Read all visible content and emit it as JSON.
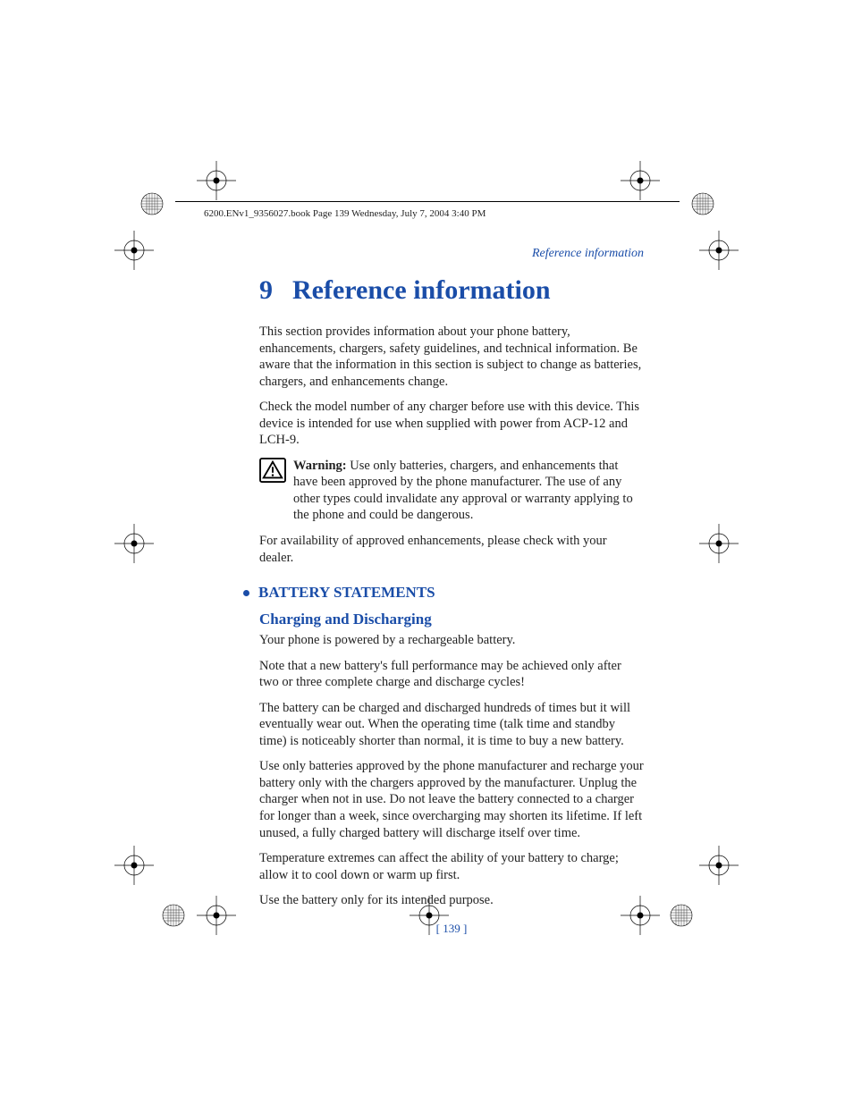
{
  "header": {
    "bookline": "6200.ENv1_9356027.book  Page 139  Wednesday, July 7, 2004  3:40 PM"
  },
  "running_head": "Reference information",
  "chapter": {
    "number": "9",
    "title": "Reference information"
  },
  "paragraphs": {
    "p1": "This section provides information about your phone battery, enhancements, chargers, safety guidelines, and technical information. Be aware that the information in this section is subject to change as batteries, chargers, and enhancements change.",
    "p2": "Check the model number of any charger before use with this device. This device is intended for use when supplied with power from ACP-12 and LCH-9.",
    "warning_label": "Warning:",
    "warning_body": " Use only batteries, chargers, and enhancements that have been approved by the phone manufacturer. The use of any other types could invalidate any approval or warranty applying to the phone and could be dangerous.",
    "p3": "For availability of approved enhancements, please check with your dealer."
  },
  "section": {
    "title": "BATTERY STATEMENTS"
  },
  "subsection": {
    "title": "Charging and Discharging",
    "p1": "Your phone is powered by a rechargeable battery.",
    "p2": "Note that a new battery's full performance may be achieved only after two or three complete charge and discharge cycles!",
    "p3": "The battery can be charged and discharged hundreds of times but it will eventually wear out. When the operating time (talk time and standby time) is noticeably shorter than normal, it is time to buy a new battery.",
    "p4": "Use only batteries approved by the phone manufacturer and recharge your battery only with the chargers approved by the manufacturer. Unplug the charger when not in use. Do not leave the battery connected to a charger for longer than a week, since overcharging may shorten its lifetime. If left unused, a fully charged battery will discharge itself over time.",
    "p5": "Temperature extremes can affect the ability of your battery to charge; allow it to cool down or warm up first.",
    "p6": "Use the battery only for its intended purpose."
  },
  "page_number": "[ 139 ]"
}
